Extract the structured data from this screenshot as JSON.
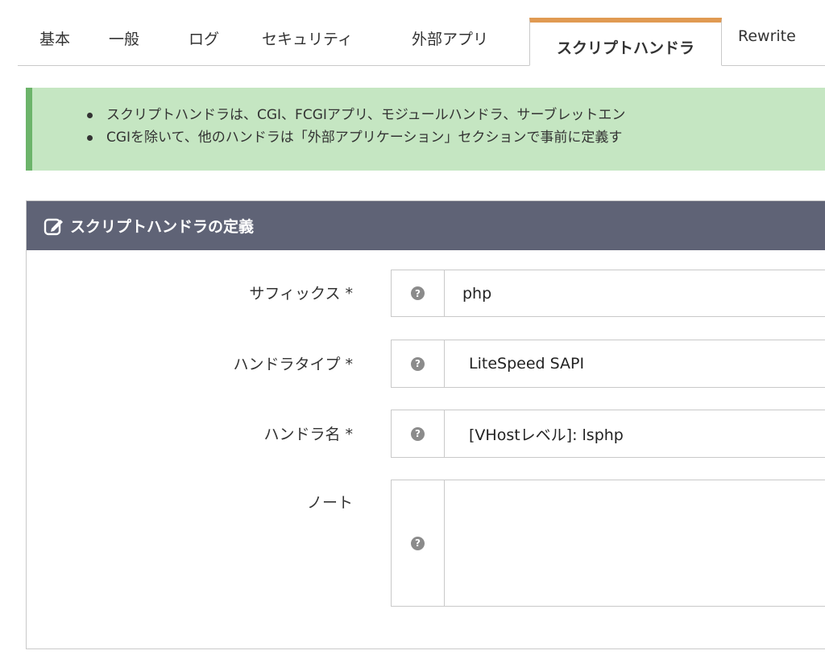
{
  "tabs": {
    "basic": "基本",
    "general": "一般",
    "log": "ログ",
    "security": "セキュリティ",
    "external_app": "外部アプリ",
    "script_handler": "スクリプトハンドラ",
    "rewrite": "Rewrite"
  },
  "notice": {
    "items": [
      "スクリプトハンドラは、CGI、FCGIアプリ、モジュールハンドラ、サーブレットエン",
      "CGIを除いて、他のハンドラは「外部アプリケーション」セクションで事前に定義す"
    ]
  },
  "panel": {
    "title": "スクリプトハンドラの定義",
    "rows": [
      {
        "label": "サフィックス *",
        "value": "php"
      },
      {
        "label": "ハンドラタイプ *",
        "value": "LiteSpeed SAPI"
      },
      {
        "label": "ハンドラ名 *",
        "value": "[VHostレベル]: lsphp"
      },
      {
        "label": "ノート",
        "value": ""
      }
    ],
    "help_glyph": "?"
  },
  "colors": {
    "active_tab_accent": "#e09a52",
    "notice_bg": "#c5e6c2",
    "notice_border": "#6cb46a",
    "panel_header_bg": "#5f6376"
  }
}
